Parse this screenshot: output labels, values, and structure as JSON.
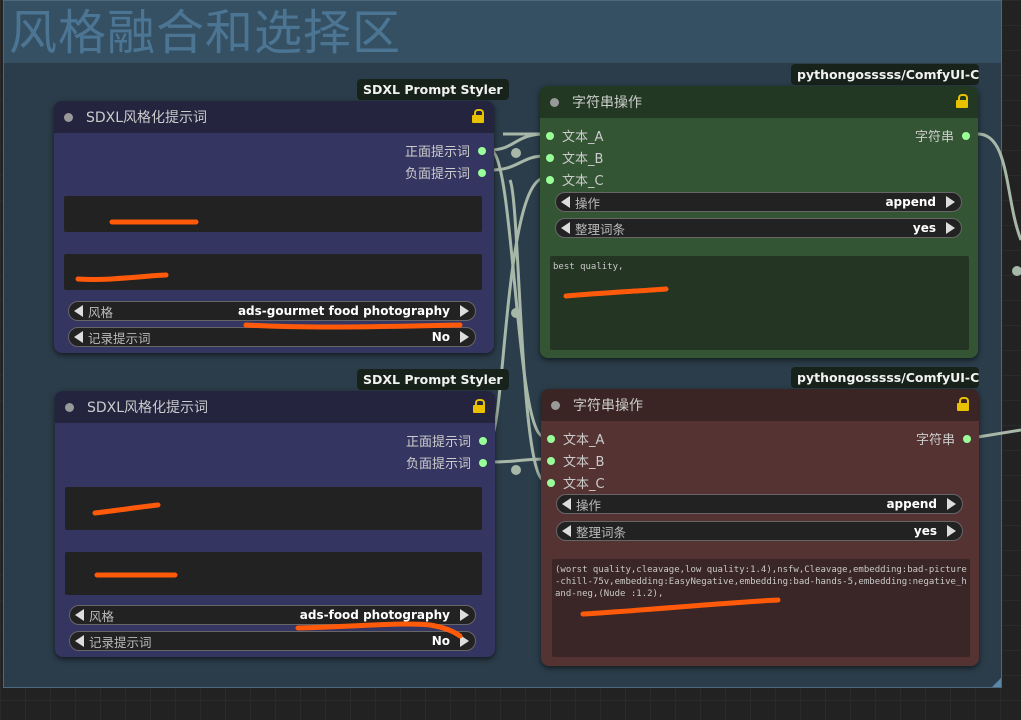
{
  "group": {
    "title": "风格融合和选择区"
  },
  "nodes": {
    "styler_top": {
      "badge": "SDXL Prompt Styler",
      "title": "SDXL风格化提示词",
      "outputs": [
        "正面提示词",
        "负面提示词"
      ],
      "widgets": [
        {
          "label": "风格",
          "value": "ads-gourmet food photography"
        },
        {
          "label": "记录提示词",
          "value": "No"
        }
      ]
    },
    "styler_bottom": {
      "badge": "SDXL Prompt Styler",
      "title": "SDXL风格化提示词",
      "outputs": [
        "正面提示词",
        "负面提示词"
      ],
      "widgets": [
        {
          "label": "风格",
          "value": "ads-food photography"
        },
        {
          "label": "记录提示词",
          "value": "No"
        }
      ]
    },
    "string_top": {
      "badge": "pythongosssss/ComfyUI-C...",
      "title": "字符串操作",
      "inputs": [
        "文本_A",
        "文本_B",
        "文本_C"
      ],
      "output": "字符串",
      "widgets": [
        {
          "label": "操作",
          "value": "append"
        },
        {
          "label": "整理词条",
          "value": "yes"
        }
      ],
      "text": "best quality,"
    },
    "string_bottom": {
      "badge": "pythongosssss/ComfyUI-C...",
      "title": "字符串操作",
      "inputs": [
        "文本_A",
        "文本_B",
        "文本_C"
      ],
      "output": "字符串",
      "widgets": [
        {
          "label": "操作",
          "value": "append"
        },
        {
          "label": "整理词条",
          "value": "yes"
        }
      ],
      "text": "(worst quality,cleavage,low quality:1.4),nsfw,Cleavage,embedding:bad-picture-chill-75v,embedding:EasyNegative,embedding:bad-hands-5,embedding:negative_hand-neg,(Nude :1.2),"
    }
  },
  "colors": {
    "annotation": "#ff5a0a",
    "link": "#a8b8a8",
    "lock": "#e8c100",
    "slot": "#99ff99"
  },
  "icons": [
    "lock-icon",
    "left-arrow-icon",
    "right-arrow-icon"
  ]
}
